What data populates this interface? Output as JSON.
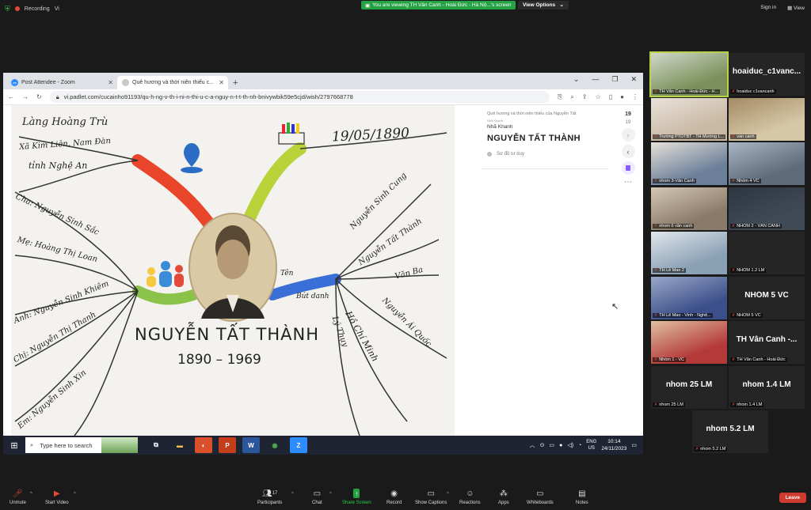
{
  "topbar": {
    "recording": "Recording",
    "user_initial": "Vi",
    "viewing": "You are viewing TH Vân Canh - Hoài Đức - Hà Nộ...'s screen",
    "view_options": "View Options",
    "sign_in": "Sign in",
    "view": "View"
  },
  "browser": {
    "tabs": [
      {
        "label": "Post Attendee - Zoom"
      },
      {
        "label": "Quê hương và thời niên thiếu c..."
      }
    ],
    "url": "vi.padlet.com/cucainho91193/qu-h-ng-v-th-i-ni-n-thi-u-c-a-nguy-n-t-t-th-nh-bnivywbik59e5cjd/wish/2797668778"
  },
  "mindmap": {
    "title": "NGUYỄN TẤT THÀNH",
    "years": "1890 – 1969",
    "date": "19/05/1890",
    "branches_left": [
      "Làng Hoàng Trù",
      "Xã Kim Liên, Nam Đàn",
      "tỉnh Nghệ An",
      "Cha: Nguyễn Sinh Sắc",
      "Mẹ: Hoàng Thị Loan",
      "Anh: Nguyễn Sinh Khiêm",
      "Chị: Nguyễn Thị Thanh",
      "Em: Nguyễn Sinh Xin"
    ],
    "branches_right": [
      "Nguyễn Sinh Cung",
      "Nguyễn Tất Thành",
      "Văn Ba",
      "Nguyễn Ái Quốc",
      "Hồ Chí Minh",
      "Lý Thụy",
      "Tên",
      "Bút danh"
    ]
  },
  "panel": {
    "crumb": "Quê hương và thời niên thiếu của Nguyễn Tất",
    "author_small": "Nhã Khanh",
    "author": "Nhã Khanh",
    "title": "NGUYỄN TẤT THÀNH",
    "category": "Sơ đồ tư duy",
    "count": "19",
    "count_total": "19"
  },
  "taskbar": {
    "search": "Type here to search",
    "lang1": "ENG",
    "lang2": "US",
    "time": "10:14",
    "date": "24/11/2023"
  },
  "gallery": [
    {
      "name": "TH Vân Canh - Hoài Đức - H...",
      "big": "",
      "photo": true
    },
    {
      "name": "hoaiduc c1vancanh",
      "big": "hoaiduc_c1vanc...",
      "photo": false
    },
    {
      "name": "Trường PTDTBT - TH Mường L...",
      "big": "",
      "photo": true
    },
    {
      "name": "van canh",
      "big": "",
      "photo": true
    },
    {
      "name": "nhom 3-Vân Canh",
      "big": "",
      "photo": true
    },
    {
      "name": "Nhóm 4 VC",
      "big": "",
      "photo": true
    },
    {
      "name": "nhom 6 vân canh",
      "big": "",
      "photo": true
    },
    {
      "name": "NHÓM 2 - VÂN CANH",
      "big": "",
      "photo": true
    },
    {
      "name": "TH Lê Mao 2",
      "big": "",
      "photo": true
    },
    {
      "name": "NHÓM 1.2 LM",
      "big": "",
      "photo": false
    },
    {
      "name": "TH Lê Mao - Vinh - Nghệ...",
      "big": "",
      "photo": true
    },
    {
      "name": "NHÓM 5 VC",
      "big": "NHÓM 5 VC",
      "photo": false
    },
    {
      "name": "Nhóm 1 - VC",
      "big": "",
      "photo": true
    },
    {
      "name": "TH Vân Canh - Hoài Đức",
      "big": "TH Vân Canh -...",
      "photo": false
    },
    {
      "name": "nhom 25 LM",
      "big": "nhom 25 LM",
      "photo": false
    },
    {
      "name": "nhom 1.4 LM",
      "big": "nhom 1.4 LM",
      "photo": false
    },
    {
      "name": "nhom 5.2 LM",
      "big": "nhom 5.2 LM",
      "photo": false
    }
  ],
  "controls": {
    "unmute": "Unmute",
    "start_video": "Start Video",
    "participants": "Participants",
    "participant_count": "17",
    "chat": "Chat",
    "share_screen": "Share Screen",
    "record": "Record",
    "captions": "Show Captions",
    "reactions": "Reactions",
    "apps": "Apps",
    "whiteboards": "Whiteboards",
    "notes": "Notes",
    "leave": "Leave"
  },
  "colors": {
    "zoom_green": "#25a244",
    "leave_red": "#d13a2f",
    "active_speaker": "#b8d24a"
  }
}
